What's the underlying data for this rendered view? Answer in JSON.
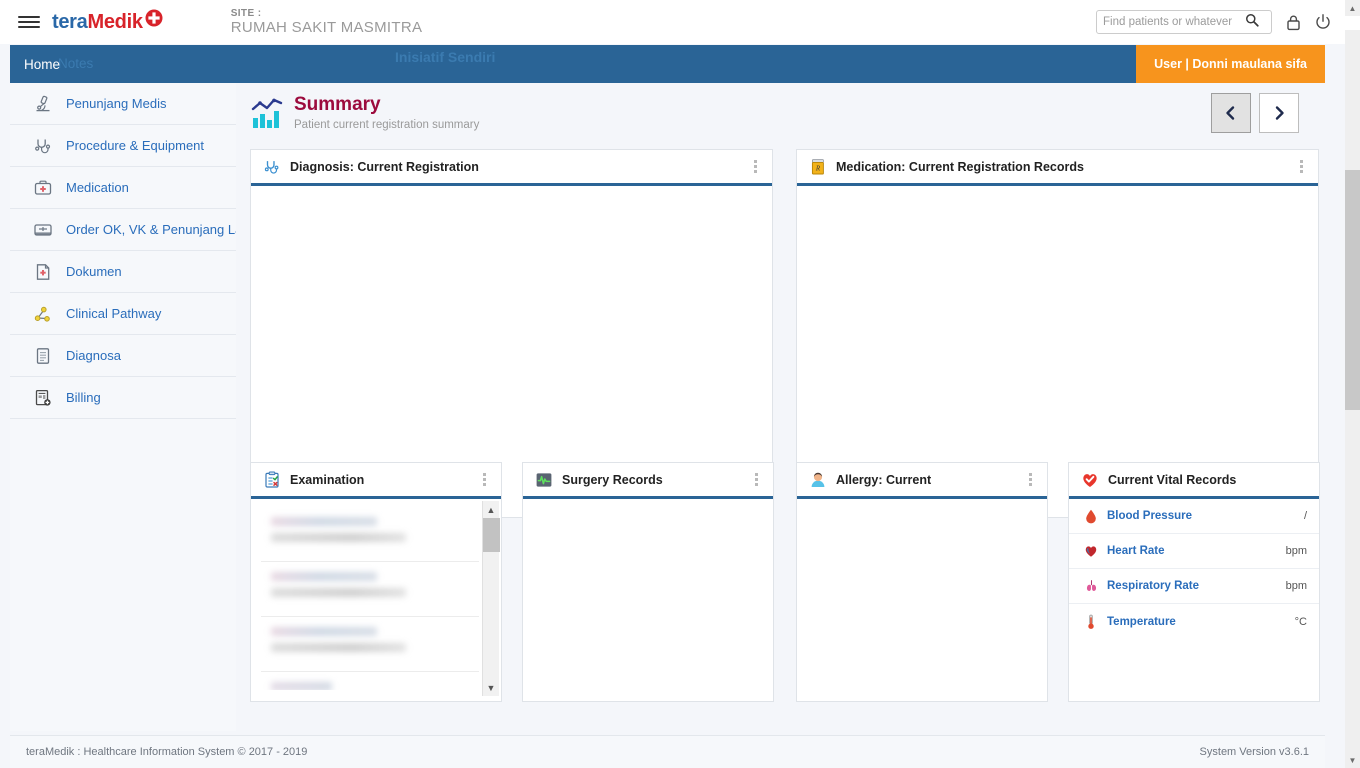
{
  "header": {
    "menu_icon": "hamburger-icon",
    "brand_part1": "tera",
    "brand_part2": "Medik",
    "brand_cross_icon": "medical-cross-icon",
    "site_label": "SITE :",
    "site_name": "RUMAH SAKIT MASMITRA",
    "search_placeholder": "Find patients or whatever",
    "search_value": "",
    "search_icon": "search-icon",
    "lock_icon": "lock-icon",
    "power_icon": "power-icon"
  },
  "navbar": {
    "home_label": "Home",
    "ghost_notes": "Notes",
    "ghost_inisiatif": "Inisiatif Sendiri",
    "user_badge": "User | Donni maulana sifa"
  },
  "sidebar": {
    "items": [
      {
        "label": "Penunjang Medis",
        "icon": "microscope-icon"
      },
      {
        "label": "Procedure & Equipment",
        "icon": "stethoscope-icon"
      },
      {
        "label": "Medication",
        "icon": "medkit-icon"
      },
      {
        "label": "Order OK, VK & Penunjang La",
        "icon": "monitor-icon"
      },
      {
        "label": "Dokumen",
        "icon": "document-icon"
      },
      {
        "label": "Clinical Pathway",
        "icon": "pathway-icon"
      },
      {
        "label": "Diagnosa",
        "icon": "notes-icon"
      },
      {
        "label": "Billing",
        "icon": "billing-icon"
      }
    ]
  },
  "page": {
    "title": "Summary",
    "subtitle": "Patient current registration summary",
    "title_icon": "bar-chart-icon",
    "prev_label": "‹",
    "next_label": "›",
    "accent_blue": "#2a6496",
    "accent_orange": "#f7941d",
    "title_color": "#9c0b3d"
  },
  "panels": {
    "diagnosis": {
      "title": "Diagnosis: Current Registration",
      "icon": "stethoscope-icon",
      "menu_icon": "kebab-menu-icon",
      "content": ""
    },
    "medication": {
      "title": "Medication: Current Registration Records",
      "icon": "pill-bottle-icon",
      "menu_icon": "kebab-menu-icon",
      "content": ""
    },
    "examination": {
      "title": "Examination",
      "icon": "clipboard-check-icon",
      "menu_icon": "kebab-menu-icon"
    },
    "surgery": {
      "title": "Surgery Records",
      "icon": "ecg-monitor-icon",
      "menu_icon": "kebab-menu-icon",
      "content": ""
    },
    "allergy": {
      "title": "Allergy: Current",
      "icon": "person-icon",
      "menu_icon": "kebab-menu-icon",
      "content": ""
    },
    "vitals": {
      "title": "Current Vital Records",
      "icon": "heart-check-icon"
    }
  },
  "vitals": {
    "rows": [
      {
        "name": "Blood Pressure",
        "value": "",
        "unit": "/",
        "icon": "blood-drop-icon"
      },
      {
        "name": "Heart Rate",
        "value": "",
        "unit": "bpm",
        "icon": "heart-icon"
      },
      {
        "name": "Respiratory Rate",
        "value": "",
        "unit": "bpm",
        "icon": "lungs-icon"
      },
      {
        "name": "Temperature",
        "value": "",
        "unit": "°C",
        "icon": "thermometer-icon"
      }
    ]
  },
  "examination": {
    "rows": [
      {
        "redacted": true
      },
      {
        "redacted": true
      },
      {
        "redacted": true
      },
      {
        "redacted": true
      }
    ],
    "scroll_up_icon": "chevron-up-icon",
    "scroll_down_icon": "chevron-down-icon"
  },
  "footer": {
    "left": "teraMedik : Healthcare Information System © 2017 - 2019",
    "right": "System Version v3.6.1"
  }
}
